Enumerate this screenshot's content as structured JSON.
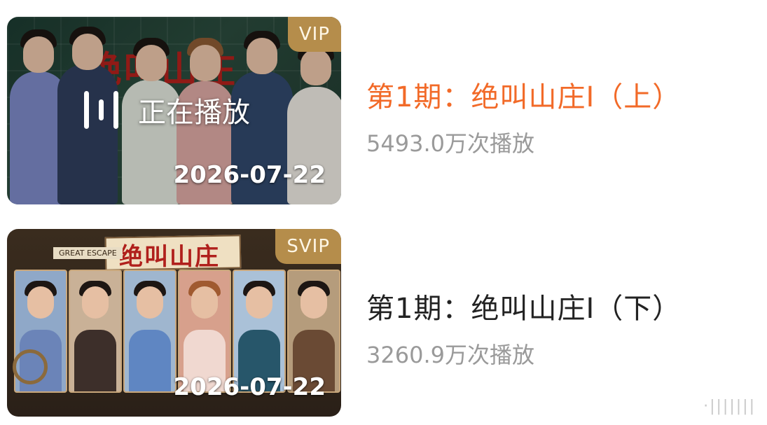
{
  "episodes": [
    {
      "badge": "VIP",
      "title": "第1期：绝叫山庄I（上）",
      "plays": "5493.0万次播放",
      "date": "2026-07-22",
      "playing_label": "正在播放",
      "logo": "绝叫山庄",
      "state": "playing",
      "title_color": "#f26a28"
    },
    {
      "badge": "SVIP",
      "title": "第1期：绝叫山庄I（下）",
      "plays": "3260.9万次播放",
      "date": "2026-07-22",
      "logo": "绝叫山庄",
      "tag": "GREAT ESCAPE",
      "title_color": "#222222"
    }
  ],
  "watermark": "·|||||||"
}
